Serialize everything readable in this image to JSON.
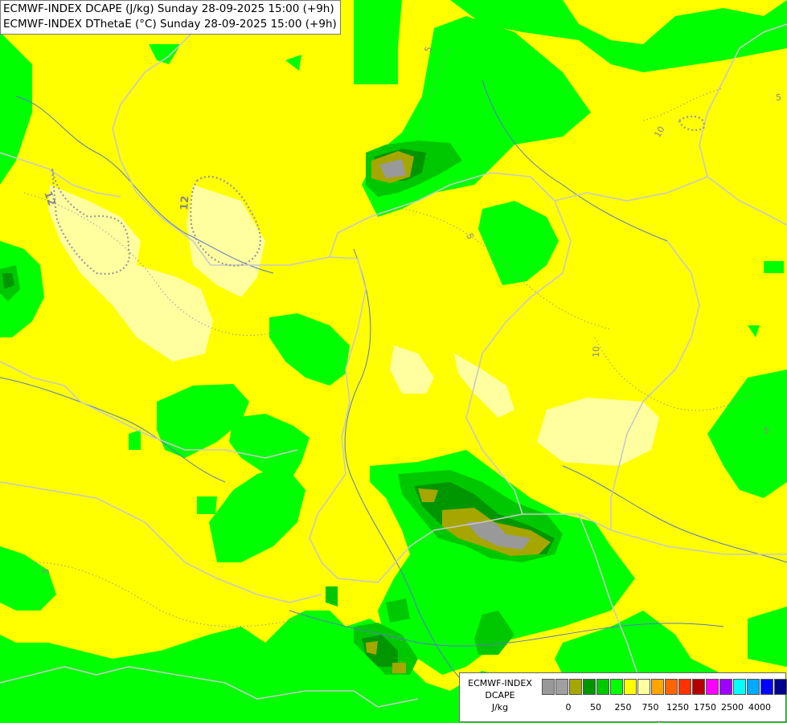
{
  "title_lines": [
    "ECMWF-INDEX DCAPE (J/kg) Sunday 28-09-2025 15:00 (+9h)",
    "ECMWF-INDEX DThetaE (°C) Sunday 28-09-2025 15:00 (+9h)"
  ],
  "legend": {
    "title": [
      "ECMWF-INDEX",
      "DCAPE",
      "J/kg"
    ],
    "colors": [
      "#999999",
      "#a0a0a0",
      "#a6a600",
      "#009600",
      "#00c800",
      "#00ff00",
      "#ffff00",
      "#ffffa0",
      "#ffa500",
      "#ff6400",
      "#ff3200",
      "#b40000",
      "#ff00ff",
      "#a000ff",
      "#00ffff",
      "#00aaff",
      "#0000ff",
      "#00008c"
    ],
    "tick_labels": [
      "0",
      "50",
      "250",
      "750",
      "1250",
      "1750",
      "2500",
      "4000"
    ]
  },
  "contour_labels": [
    "5",
    "12",
    "12",
    "5",
    "10",
    "10",
    "5",
    "5",
    "5"
  ],
  "colors": {
    "background": "#ffff00",
    "light_yellow": "#ffffa0",
    "light_green": "#00ff00",
    "mid_green": "#00c800",
    "dark_green": "#009600",
    "olive": "#a6a600",
    "gray": "#999999",
    "border": "#c8c8c8",
    "river": "#5a78c8"
  }
}
